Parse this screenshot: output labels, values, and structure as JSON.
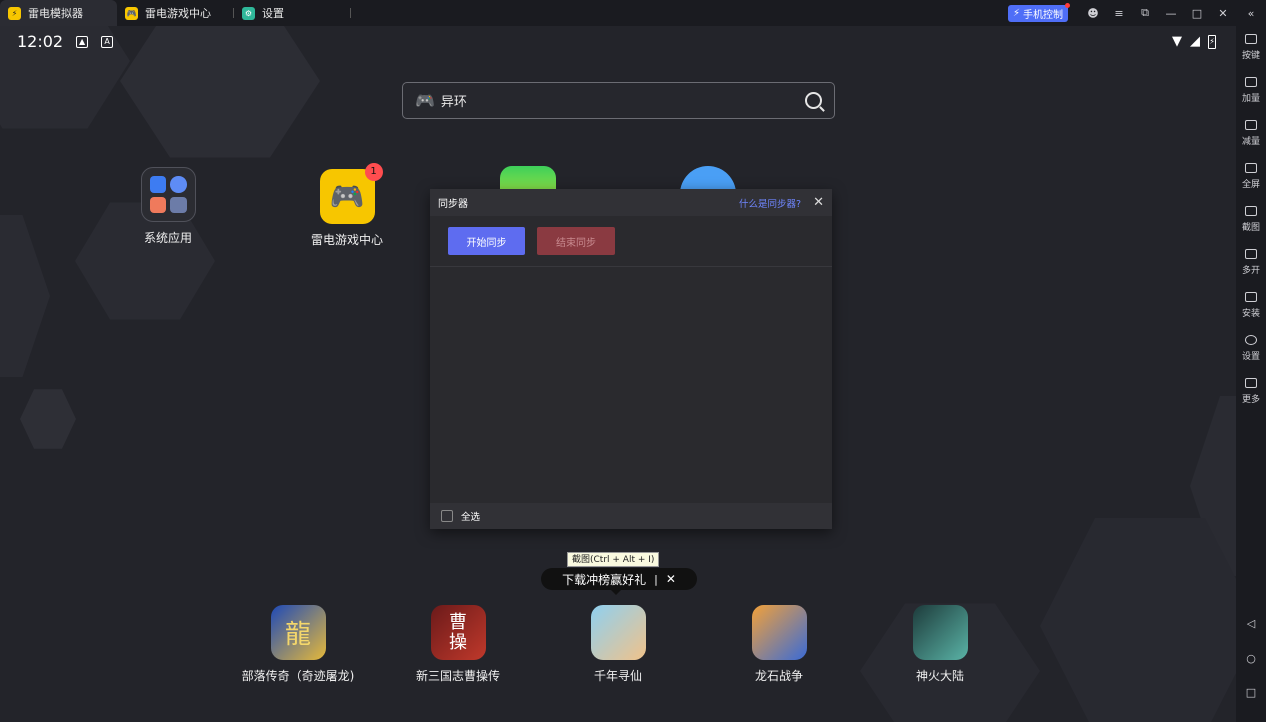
{
  "titlebar": {
    "tabs": [
      {
        "label": "雷电模拟器",
        "icon": "ldplayer-icon",
        "color": "#f7c600"
      },
      {
        "label": "雷电游戏中心",
        "icon": "game-center-icon",
        "color": "#f7c600"
      },
      {
        "label": "设置",
        "icon": "settings-icon",
        "color": "#2fb89a"
      }
    ],
    "phone_control": "手机控制"
  },
  "status": {
    "time": "12:02"
  },
  "search": {
    "value": "异环"
  },
  "apps_top": [
    {
      "label": "系统应用"
    },
    {
      "label": "雷电游戏中心",
      "badge": "1"
    }
  ],
  "dialog": {
    "title": "同步器",
    "help_link": "什么是同步器?",
    "start_label": "开始同步",
    "end_label": "结束同步",
    "select_all": "全选"
  },
  "tooltip": "截图(Ctrl + Alt + I)",
  "promo": {
    "text": "下载冲榜赢好礼"
  },
  "apps_bottom": [
    {
      "label": "部落传奇（奇迹屠龙)"
    },
    {
      "label": "新三国志曹操传"
    },
    {
      "label": "千年寻仙"
    },
    {
      "label": "龙石战争"
    },
    {
      "label": "神火大陆"
    }
  ],
  "sidebar": {
    "items": [
      {
        "label": "按键"
      },
      {
        "label": "加量"
      },
      {
        "label": "减量"
      },
      {
        "label": "全屏"
      },
      {
        "label": "截图"
      },
      {
        "label": "多开"
      },
      {
        "label": "安装"
      },
      {
        "label": "设置"
      },
      {
        "label": "更多"
      }
    ]
  }
}
